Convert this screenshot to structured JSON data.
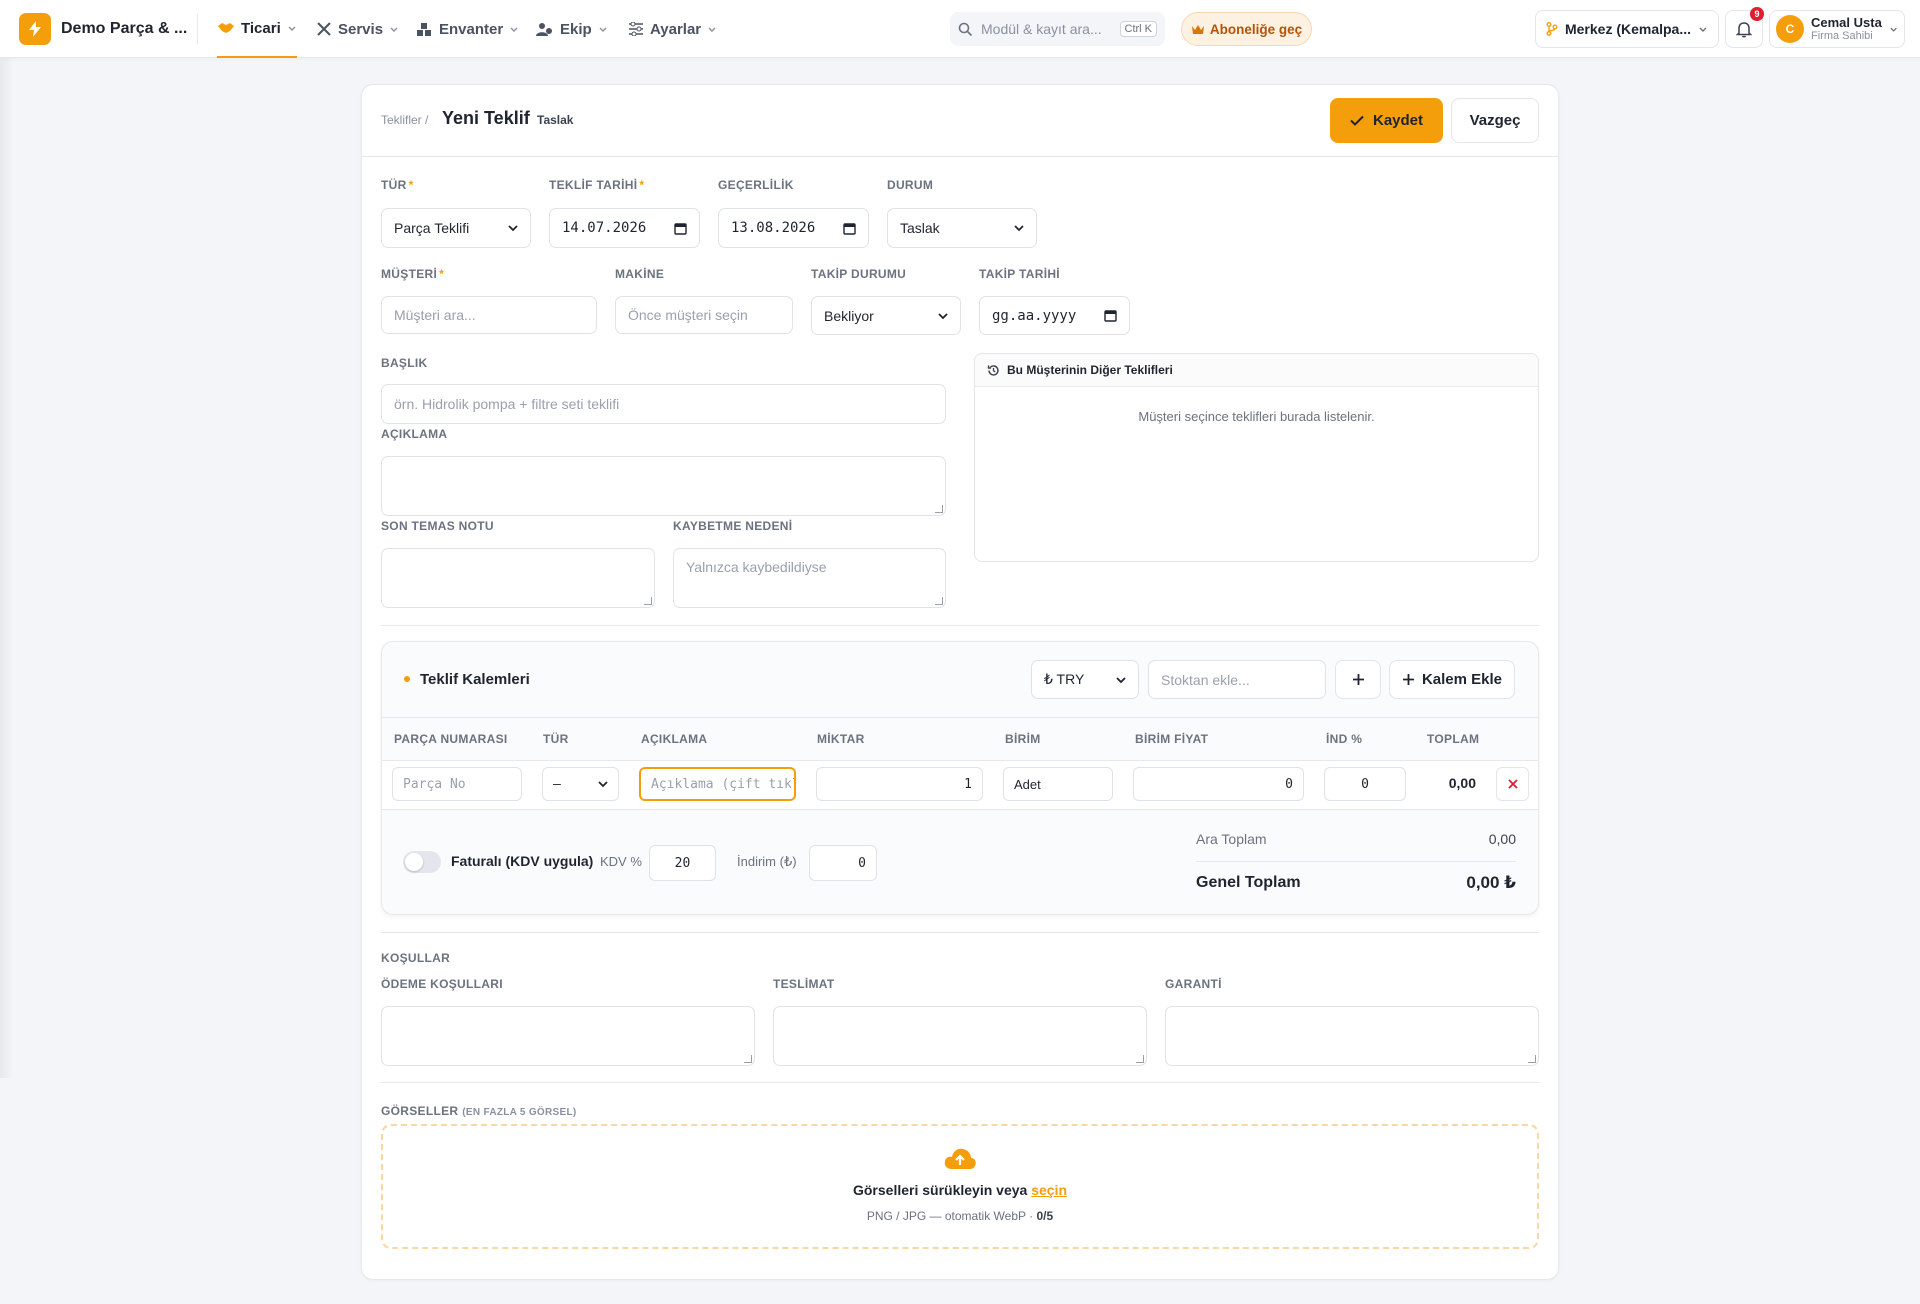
{
  "topbar": {
    "brand": "Demo Parça & ...",
    "nav": [
      {
        "label": "Ticari",
        "icon": "handshake-icon"
      },
      {
        "label": "Servis",
        "icon": "wrench-icon"
      },
      {
        "label": "Envanter",
        "icon": "boxes-icon"
      },
      {
        "label": "Ekip",
        "icon": "team-icon"
      },
      {
        "label": "Ayarlar",
        "icon": "sliders-icon"
      }
    ],
    "search_placeholder": "Modül & kayıt ara...",
    "search_shortcut": "Ctrl K",
    "subscribe": "Aboneliğe geç",
    "branch": "Merkez (Kemalpa...",
    "notification_count": "9",
    "user": {
      "initial": "C",
      "name": "Cemal Usta",
      "role": "Firma Sahibi"
    }
  },
  "header": {
    "breadcrumb": "Teklifler /",
    "title": "Yeni Teklif",
    "status_chip": "Taslak",
    "save": "Kaydet",
    "cancel": "Vazgeç"
  },
  "form": {
    "tur": {
      "label": "TÜR",
      "value": "Parça Teklifi"
    },
    "teklif_tarihi": {
      "label": "TEKLİF TARİHİ",
      "value": "14.07.2026"
    },
    "gecerlilik": {
      "label": "GEÇERLİLİK",
      "value": "13.08.2026"
    },
    "durum": {
      "label": "DURUM",
      "value": "Taslak"
    },
    "musteri": {
      "label": "MÜŞTERİ",
      "placeholder": "Müşteri ara..."
    },
    "makine": {
      "label": "MAKİNE",
      "placeholder": "Önce müşteri seçin"
    },
    "takip_durumu": {
      "label": "TAKİP DURUMU",
      "value": "Bekliyor"
    },
    "takip_tarihi": {
      "label": "TAKİP TARİHİ",
      "placeholder": "gg.aa.yyyy"
    },
    "baslik": {
      "label": "BAŞLIK",
      "placeholder": "örn. Hidrolik pompa + filtre seti teklifi"
    },
    "aciklama": {
      "label": "AÇIKLAMA"
    },
    "son_temas": {
      "label": "SON TEMAS NOTU"
    },
    "kaybetme": {
      "label": "KAYBETME NEDENİ",
      "placeholder": "Yalnızca kaybedildiyse"
    },
    "other_offers": {
      "title": "Bu Müşterinin Diğer Teklifleri",
      "empty": "Müşteri seçince teklifleri burada listelenir."
    }
  },
  "items": {
    "title": "Teklif Kalemleri",
    "currency": "₺ TRY",
    "stock_placeholder": "Stoktan ekle...",
    "add_item": "Kalem Ekle",
    "columns": [
      "PARÇA NUMARASI",
      "TÜR",
      "AÇIKLAMA",
      "MİKTAR",
      "BİRİM",
      "BİRİM FİYAT",
      "İND %",
      "TOPLAM"
    ],
    "rows": [
      {
        "part_placeholder": "Parça No",
        "type": "—",
        "desc_placeholder": "Açıklama (çift tıkla düze",
        "qty": "1",
        "unit": "Adet",
        "price": "0",
        "discount": "0",
        "total": "0,00"
      }
    ],
    "invoiced_label": "Faturalı (KDV uygula)",
    "kdv_label": "KDV %",
    "kdv_value": "20",
    "discount_label": "İndirim (₺)",
    "discount_value": "0",
    "subtotal_label": "Ara Toplam",
    "subtotal_value": "0,00",
    "grand_total_label": "Genel Toplam",
    "grand_total_value": "0,00 ₺"
  },
  "terms": {
    "section": "KOŞULLAR",
    "payment": "ÖDEME KOŞULLARI",
    "delivery": "TESLİMAT",
    "warranty": "GARANTİ"
  },
  "images": {
    "label": "GÖRSELLER",
    "hint": "(EN FAZLA 5 GÖRSEL)",
    "drop_text": "Görselleri sürükleyin veya",
    "drop_link": "seçin",
    "formats": "PNG / JPG — otomatik WebP ·",
    "count": "0/5"
  },
  "colors": {
    "accent": "#f59e0b",
    "danger": "#e11d2e"
  }
}
